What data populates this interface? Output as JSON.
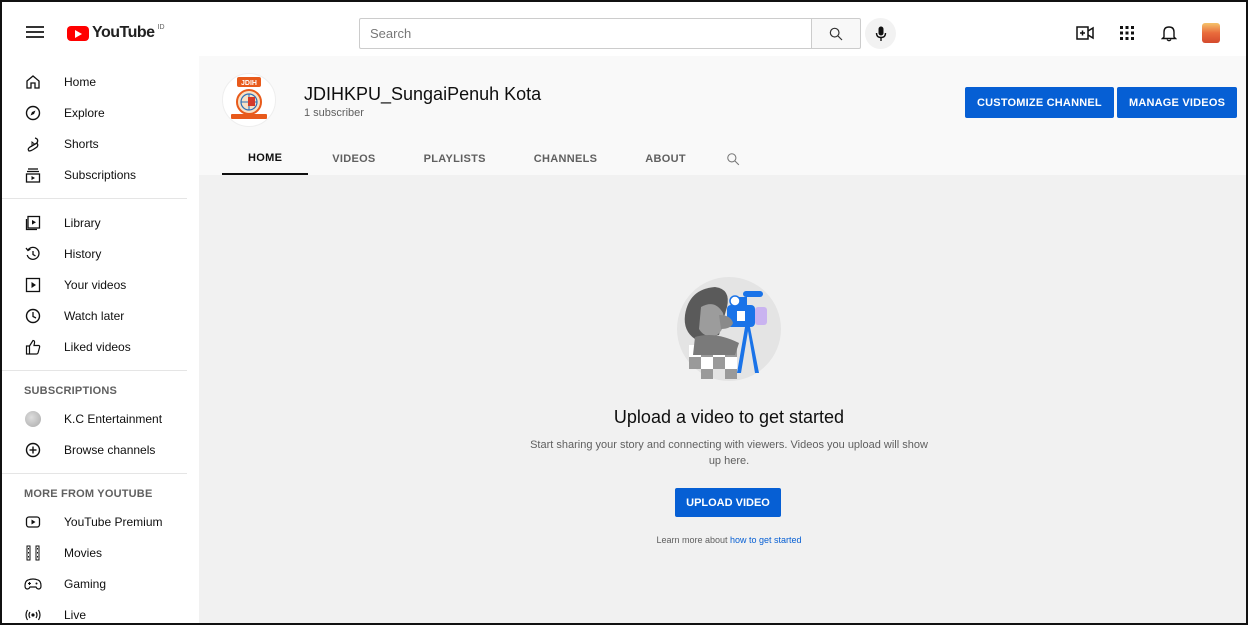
{
  "topbar": {
    "logo_text": "YouTube",
    "region": "ID",
    "search_placeholder": "Search"
  },
  "sidebar": {
    "main": [
      {
        "label": "Home",
        "icon": "home-icon"
      },
      {
        "label": "Explore",
        "icon": "compass-icon"
      },
      {
        "label": "Shorts",
        "icon": "shorts-icon"
      },
      {
        "label": "Subscriptions",
        "icon": "subscriptions-icon"
      }
    ],
    "library": [
      {
        "label": "Library",
        "icon": "library-icon"
      },
      {
        "label": "History",
        "icon": "history-icon"
      },
      {
        "label": "Your videos",
        "icon": "your-videos-icon"
      },
      {
        "label": "Watch later",
        "icon": "clock-icon"
      },
      {
        "label": "Liked videos",
        "icon": "thumbs-up-icon"
      }
    ],
    "subscriptions_heading": "SUBSCRIPTIONS",
    "subscriptions": [
      {
        "label": "K.C Entertainment",
        "icon": "channel-avatar"
      },
      {
        "label": "Browse channels",
        "icon": "plus-circle-icon"
      }
    ],
    "more_heading": "MORE FROM YOUTUBE",
    "more": [
      {
        "label": "YouTube Premium",
        "icon": "youtube-premium-icon"
      },
      {
        "label": "Movies",
        "icon": "movies-icon"
      },
      {
        "label": "Gaming",
        "icon": "gaming-icon"
      },
      {
        "label": "Live",
        "icon": "live-icon"
      }
    ]
  },
  "channel": {
    "name": "JDIHKPU_SungaiPenuh Kota",
    "subscribers": "1 subscriber",
    "avatar_text": "JDIH",
    "customize_label": "CUSTOMIZE CHANNEL",
    "manage_label": "MANAGE VIDEOS",
    "tabs": [
      "HOME",
      "VIDEOS",
      "PLAYLISTS",
      "CHANNELS",
      "ABOUT"
    ]
  },
  "main": {
    "title": "Upload a video to get started",
    "description": "Start sharing your story and connecting with viewers. Videos you upload will show up here.",
    "upload_label": "UPLOAD VIDEO",
    "learn_prefix": "Learn more about ",
    "learn_link": "how to get started"
  },
  "colors": {
    "accent": "#065fd4",
    "brand": "#ff0000",
    "header_bg": "#f9f9f9",
    "main_bg": "#f1f1f1"
  }
}
